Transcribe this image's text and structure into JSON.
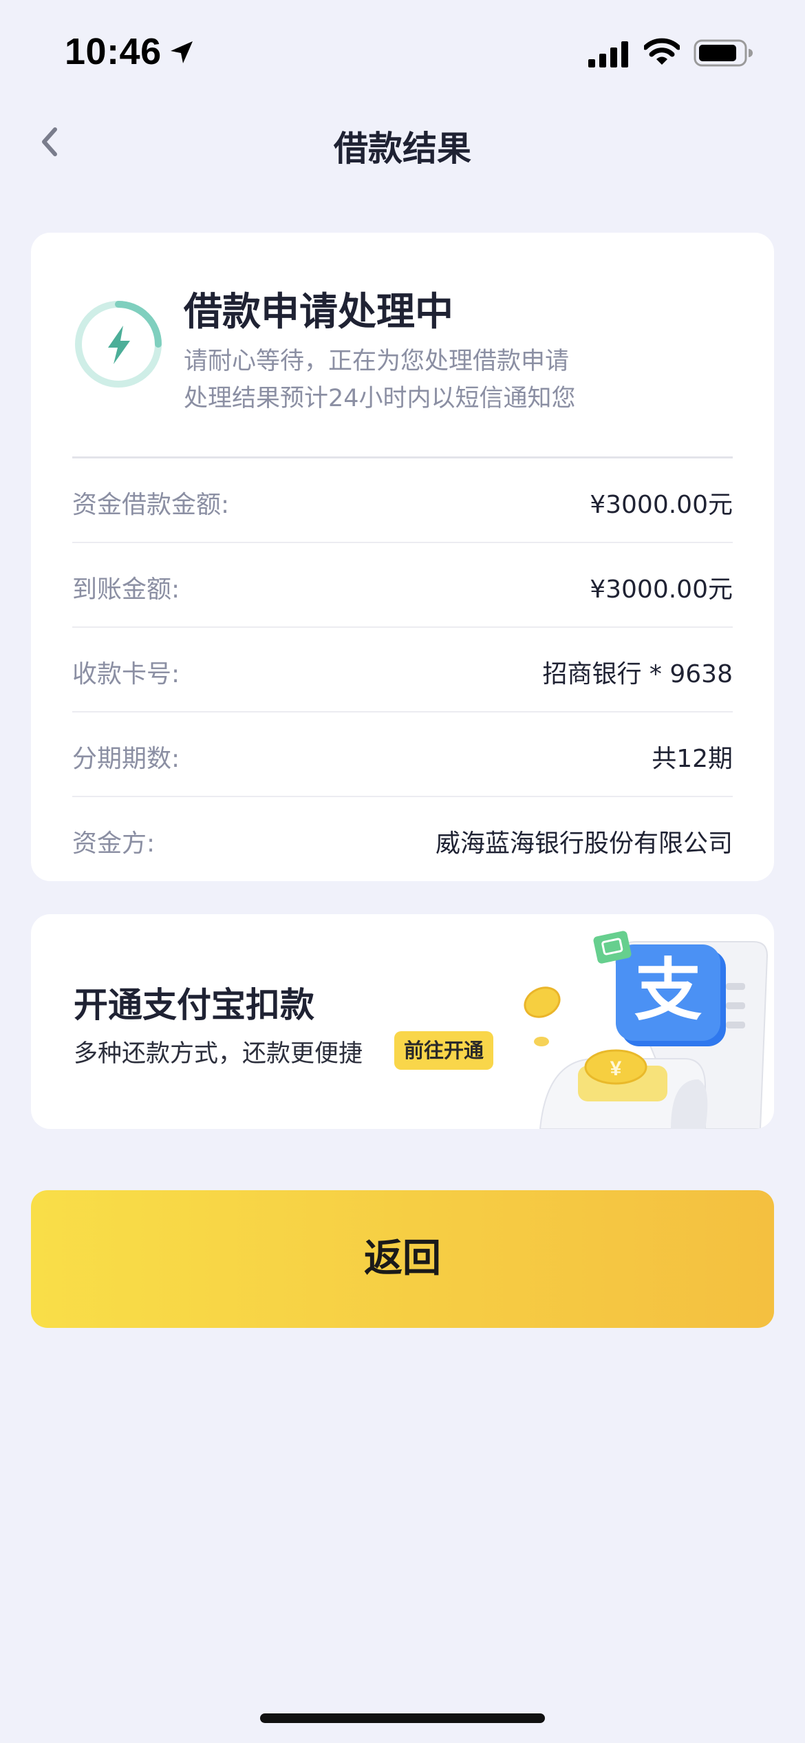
{
  "status_bar": {
    "time": "10:46"
  },
  "nav": {
    "title": "借款结果"
  },
  "result": {
    "heading": "借款申请处理中",
    "line1": "请耐心等待，正在为您处理借款申请",
    "line2": "处理结果预计24小时内以短信通知您",
    "details": [
      {
        "label": "资金借款金额:",
        "value": "¥3000.00元"
      },
      {
        "label": "到账金额:",
        "value": "¥3000.00元"
      },
      {
        "label": "收款卡号:",
        "value": "招商银行 * 9638"
      },
      {
        "label": "分期期数:",
        "value": "共12期"
      },
      {
        "label": "资金方:",
        "value": "威海蓝海银行股份有限公司"
      }
    ]
  },
  "promo": {
    "title": "开通支付宝扣款",
    "subtitle": "多种还款方式，还款更便捷",
    "cta": "前往开通",
    "logo_char": "支",
    "coin_symbol": "¥"
  },
  "actions": {
    "return_label": "返回"
  },
  "colors": {
    "background": "#f0f1fa",
    "accent_yellow": "#f6cd44",
    "ring_teal": "#7fcfbe"
  },
  "icons": {
    "back": "chevron-left-icon",
    "status": "lightning-icon",
    "location": "location-arrow-icon",
    "signal": "cellular-signal-icon",
    "wifi": "wifi-icon",
    "battery": "battery-icon"
  }
}
